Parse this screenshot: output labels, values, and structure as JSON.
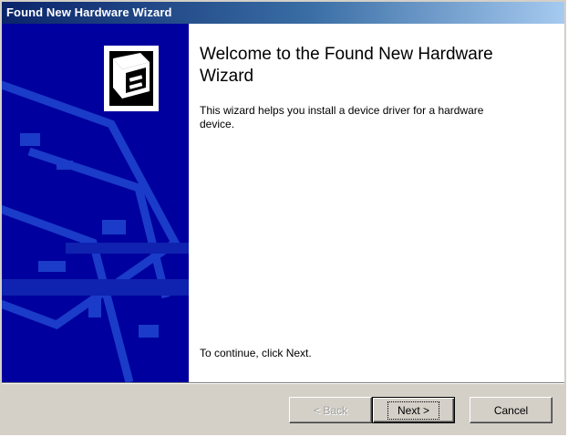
{
  "window": {
    "title": "Found New Hardware Wizard"
  },
  "content": {
    "heading": "Welcome to the Found New Hardware Wizard",
    "description": "This wizard helps you install a device driver for a hardware device.",
    "continue_text": "To continue, click Next."
  },
  "buttons": {
    "back_label": "< Back",
    "next_label": "Next >",
    "cancel_label": "Cancel",
    "back_enabled": false
  },
  "icons": {
    "wizard_icon": "hardware-drive-icon"
  },
  "colors": {
    "title_gradient_start": "#0a246a",
    "title_gradient_end": "#a6caf0",
    "sidebar": "#00009e",
    "dialog_face": "#d4d0c8"
  }
}
